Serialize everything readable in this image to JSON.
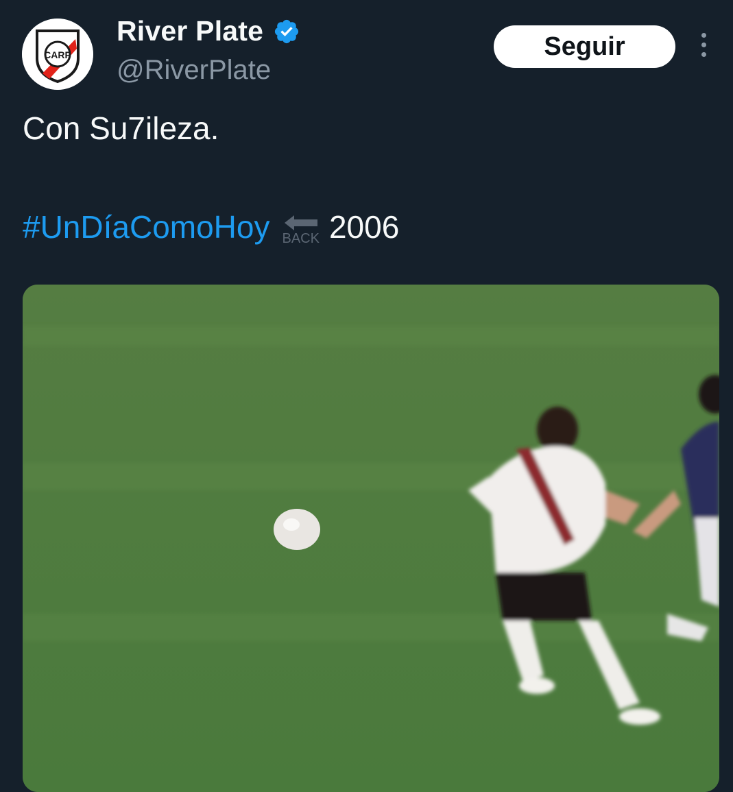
{
  "profile": {
    "display_name": "River Plate",
    "handle": "@RiverPlate",
    "avatar_monogram": "CARP",
    "verified": true
  },
  "actions": {
    "follow_label": "Seguir"
  },
  "tweet": {
    "text_line1": "Con Su7ileza.",
    "hashtag": "#UnDíaComoHoy",
    "emoji_label": "BACK",
    "emoji_name": "back-arrow-emoji",
    "year": "2006"
  },
  "media": {
    "description_icon": "video-frame"
  },
  "colors": {
    "background": "#15202b",
    "link": "#1d9bf0",
    "verified": "#1d9bf0",
    "secondary_text": "#8b98a5",
    "pitch_green": "#4f7a3e"
  }
}
